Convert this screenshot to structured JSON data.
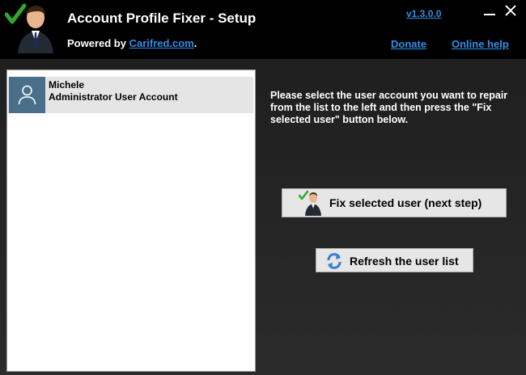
{
  "header": {
    "title": "Account Profile Fixer - Setup",
    "powered_prefix": "Powered by ",
    "powered_link": "Carifred.com",
    "powered_suffix": ".",
    "version": "v1.3.0.0",
    "donate": "Donate",
    "online_help": "Online help"
  },
  "user_list": {
    "items": [
      {
        "name": "Michele",
        "type": "Administrator User Account",
        "icon": "user-avatar-icon"
      }
    ]
  },
  "instructions": "Please select the user account you want to repair from the list to the left and then press the \"Fix selected user\" button below.",
  "buttons": {
    "fix": "Fix selected user (next step)",
    "refresh": "Refresh the user list"
  },
  "colors": {
    "link": "#2e8fe8",
    "accent_check": "#2ea82e",
    "avatar_bg": "#4a6f8a"
  }
}
